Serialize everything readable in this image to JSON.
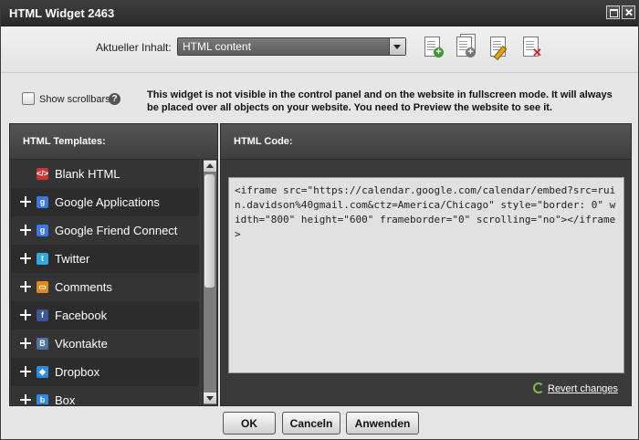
{
  "window": {
    "title": "HTML Widget 2463"
  },
  "toolbar": {
    "content_label": "Aktueller Inhalt:",
    "content_select_value": "HTML content",
    "icons": [
      "add-page-icon",
      "duplicate-page-icon",
      "edit-page-icon",
      "delete-page-icon"
    ]
  },
  "options": {
    "show_scrollbars_label": "Show scrollbars",
    "show_scrollbars_checked": false,
    "help_glyph": "?",
    "info_text": "This widget is not visible in the control panel and on the website in fullscreen mode. It will always be placed over all objects on your website. You need to Preview the website to see it."
  },
  "templates": {
    "header": "HTML Templates:",
    "items": [
      {
        "label": "Blank HTML",
        "expandable": false,
        "icon": "blank-html-icon",
        "glyph": "</>",
        "color": "#cc3333"
      },
      {
        "label": "Google Applications",
        "expandable": true,
        "icon": "google-icon",
        "glyph": "g",
        "color": "#3b78e7"
      },
      {
        "label": "Google Friend Connect",
        "expandable": true,
        "icon": "google-icon",
        "glyph": "g",
        "color": "#3b78e7"
      },
      {
        "label": "Twitter",
        "expandable": true,
        "icon": "twitter-icon",
        "glyph": "t",
        "color": "#33aadd"
      },
      {
        "label": "Comments",
        "expandable": true,
        "icon": "comments-icon",
        "glyph": "▭",
        "color": "#e08a1e"
      },
      {
        "label": "Facebook",
        "expandable": true,
        "icon": "facebook-icon",
        "glyph": "f",
        "color": "#3b5998"
      },
      {
        "label": "Vkontakte",
        "expandable": true,
        "icon": "vkontakte-icon",
        "glyph": "B",
        "color": "#4c75a3"
      },
      {
        "label": "Dropbox",
        "expandable": true,
        "icon": "dropbox-icon",
        "glyph": "◆",
        "color": "#2e8ae6"
      },
      {
        "label": "Box",
        "expandable": true,
        "icon": "box-icon",
        "glyph": "b",
        "color": "#2e8ae6"
      }
    ]
  },
  "code": {
    "header": "HTML Code:",
    "value": "<iframe src=\"https://calendar.google.com/calendar/embed?src=ruin.davidson%40gmail.com&ctz=America/Chicago\" style=\"border: 0\" width=\"800\" height=\"600\" frameborder=\"0\" scrolling=\"no\"></iframe>",
    "revert_label": "Revert changes"
  },
  "buttons": {
    "ok": "OK",
    "cancel": "Canceln",
    "apply": "Anwenden"
  }
}
